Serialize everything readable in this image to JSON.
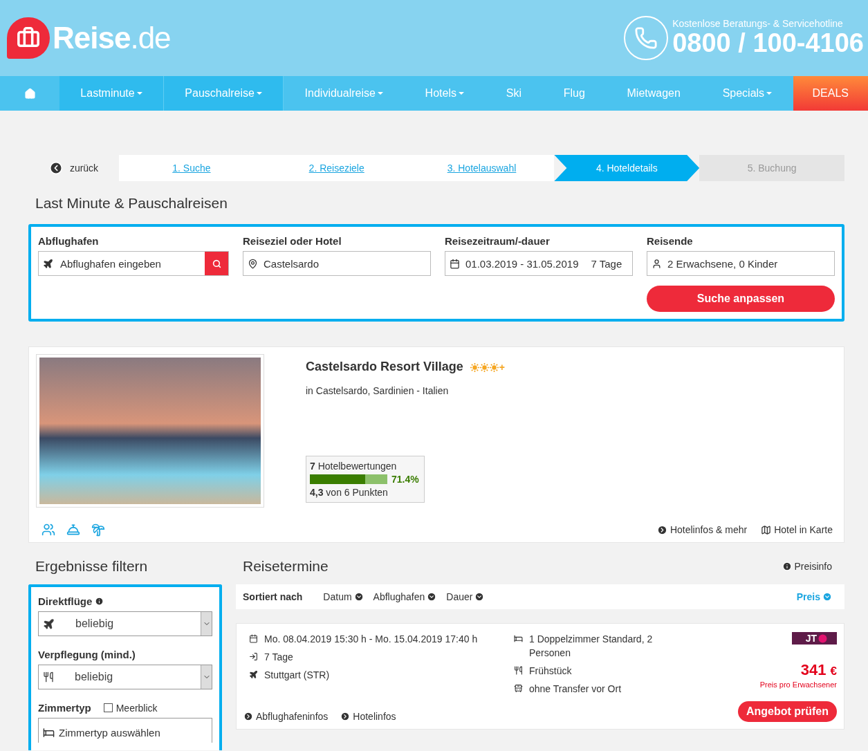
{
  "header": {
    "logo": {
      "main": "Reise",
      "suffix": ".de"
    },
    "hotline_label": "Kostenlose Beratungs- & Servicehotline",
    "hotline_number": "0800 / 100-4106"
  },
  "nav": [
    {
      "kind": "home"
    },
    {
      "kind": "link",
      "label": "Lastminute",
      "dropdown": true,
      "selected": true
    },
    {
      "kind": "link",
      "label": "Pauschalreise",
      "dropdown": true,
      "selected": true
    },
    {
      "kind": "link",
      "label": "Individualreise",
      "dropdown": true,
      "selected": false
    },
    {
      "kind": "link",
      "label": "Hotels",
      "dropdown": true,
      "selected": false
    },
    {
      "kind": "link",
      "label": "Ski",
      "dropdown": false,
      "selected": false
    },
    {
      "kind": "link",
      "label": "Flug",
      "dropdown": false,
      "selected": false
    },
    {
      "kind": "link",
      "label": "Mietwagen",
      "dropdown": false,
      "selected": false
    },
    {
      "kind": "link",
      "label": "Specials",
      "dropdown": true,
      "selected": false
    },
    {
      "kind": "deals",
      "label": "DEALS"
    }
  ],
  "steps": {
    "back": "zurück",
    "items": [
      {
        "label": "1. Suche",
        "kind": "done"
      },
      {
        "label": "2. Reiseziele",
        "kind": "done"
      },
      {
        "label": "3. Hotelauswahl",
        "kind": "done"
      },
      {
        "label": "4. Hoteldetails",
        "kind": "active"
      },
      {
        "label": "5. Buchung",
        "kind": "pending"
      }
    ]
  },
  "search": {
    "title": "Last Minute & Pauschalreisen",
    "fields": [
      {
        "label": "Abflughafen",
        "placeholder": "Abflughafen eingeben",
        "search_button": true
      },
      {
        "label": "Reiseziel oder Hotel",
        "value": "Castelsardo",
        "search_button": false
      },
      {
        "label": "Reisezeitraum/-dauer",
        "value": "01.03.2019 - 31.05.2019",
        "extra": "7 Tage",
        "search_button": false
      },
      {
        "label": "Reisende",
        "value": "2 Erwachsene, 0 Kinder",
        "search_button": false
      }
    ],
    "button": "Suche anpassen"
  },
  "hotel": {
    "name": "Castelsardo Resort Village",
    "stars": 3,
    "plus": "+",
    "location": "in Castelsardo, Sardinien - Italien",
    "rating": {
      "count": "7",
      "label": "Hotelbewertungen",
      "level": 0.714,
      "reading": "71.4%",
      "score": "4,3",
      "score_suffix": "von 6 Punkten"
    },
    "links": [
      "Hotelinfos & mehr",
      "Hotel in Karte"
    ]
  },
  "filters": {
    "title": "Ergebnisse filtern",
    "direct_flights": {
      "label": "Direktflüge",
      "value": "beliebig"
    },
    "board": {
      "label": "Verpflegung (mind.)",
      "value": "beliebig"
    },
    "room": {
      "label": "Zimmertyp",
      "seaview": {
        "label": "Meerblick",
        "checked": false
      },
      "placeholder": "Zimmertyp auswählen"
    }
  },
  "results": {
    "title": "Reisetermine",
    "price_info": "Preisinfo",
    "sort_label": "Sortiert nach",
    "sort_options": [
      {
        "label": "Datum",
        "selected": false
      },
      {
        "label": "Abflughafen",
        "selected": false
      },
      {
        "label": "Dauer",
        "selected": false
      },
      {
        "label": "Preis",
        "selected": true
      }
    ],
    "offer": {
      "dates": "Mo. 08.04.2019 15:30 h - Mo. 15.04.2019 17:40 h",
      "duration": "7 Tage",
      "airport": "Stuttgart (STR)",
      "room": "1 Doppelzimmer Standard, 2 Personen",
      "board": "Frühstück",
      "transfer": "ohne Transfer vor Ort",
      "operator": "JT",
      "price": "341",
      "currency": "€",
      "price_note": "Preis pro Erwachsener",
      "button": "Angebot prüfen",
      "links": [
        "Abflughafeninfos",
        "Hotelinfos"
      ]
    }
  }
}
